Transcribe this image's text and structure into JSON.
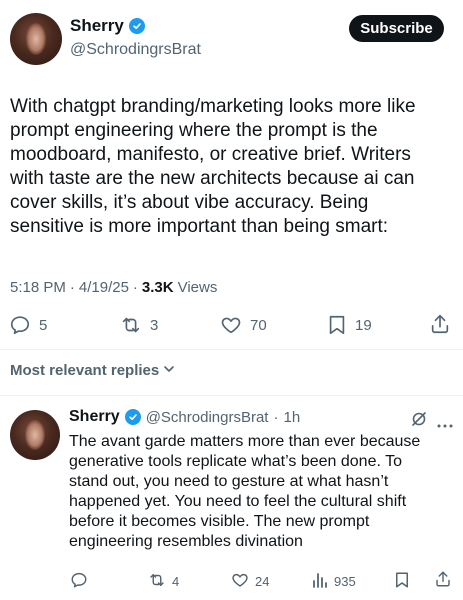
{
  "tweet": {
    "author_name": "Sherry",
    "author_handle": "@SchrodingrsBrat",
    "subscribe_label": "Subscribe",
    "lines": [
      "With chatgpt branding/marketing looks more like",
      "prompt engineering where the prompt is the",
      "moodboard, manifesto, or creative brief. Writers",
      "with taste are the new architects because ai can",
      "cover skills, it’s about vibe accuracy. Being",
      "sensitive is more important than being smart:"
    ],
    "time": "5:18 PM",
    "date": "4/19/25",
    "separator": "·",
    "views_count": "3.3K",
    "views_label": "Views",
    "replies_count": "5",
    "reposts_count": "3",
    "likes_count": "70",
    "bookmarks_count": "19"
  },
  "replies_header": {
    "label": "Most relevant replies"
  },
  "reply": {
    "author_name": "Sherry",
    "author_handle": "@SchrodingrsBrat",
    "separator": "·",
    "age": "1h",
    "lines": [
      "The avant garde matters more than ever because",
      "generative tools replicate what’s been done. To",
      "stand out, you need to gesture at what hasn’t",
      "happened yet. You need to feel the cultural shift",
      "before it becomes visible. The new prompt",
      "engineering resembles divination"
    ],
    "reposts_count": "4",
    "likes_count": "24",
    "views_count": "935"
  },
  "colors": {
    "accent": "#1d9bf0",
    "text": "#0f1419",
    "secondary": "#536471",
    "divider": "#eff3f4"
  }
}
